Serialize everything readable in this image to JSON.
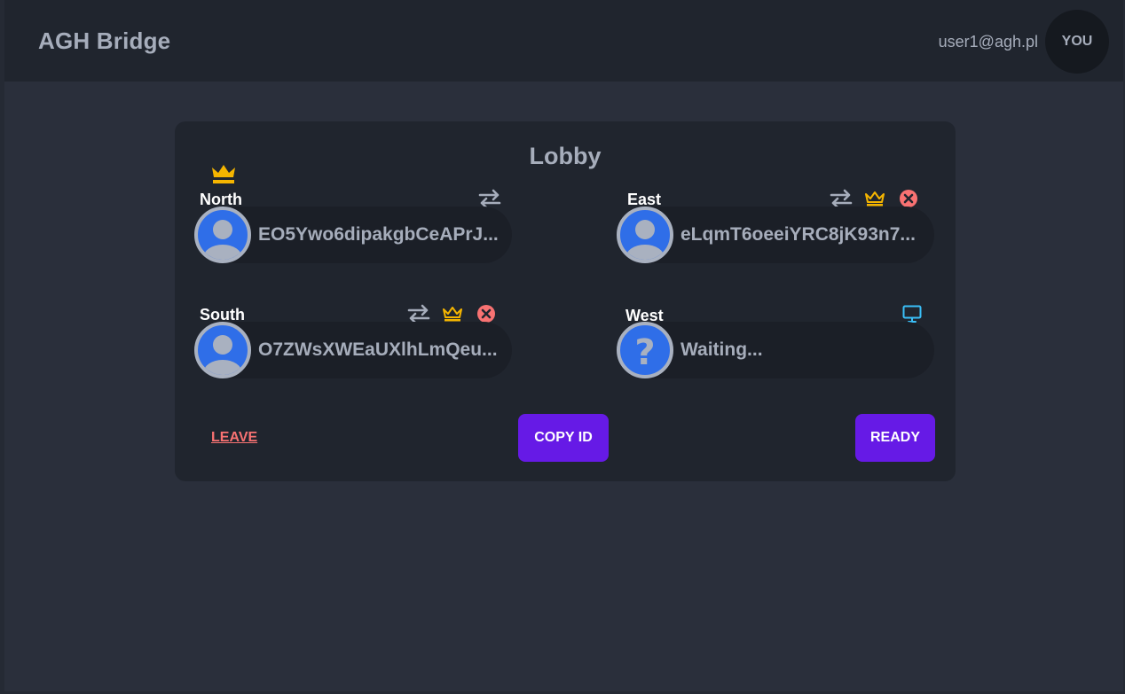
{
  "header": {
    "brand": "AGH Bridge",
    "user_email": "user1@agh.pl",
    "avatar_label": "YOU"
  },
  "lobby": {
    "title": "Lobby",
    "seats": [
      {
        "position": "North",
        "player": "EO5Ywo6dipakgbCeAPrJ...",
        "host": true,
        "actions": [
          "swap-icon"
        ]
      },
      {
        "position": "East",
        "player": "eLqmT6oeeiYRC8jK93n7...",
        "host": false,
        "actions": [
          "swap-icon",
          "crown-icon",
          "kick-icon"
        ]
      },
      {
        "position": "South",
        "player": "O7ZWsXWEaUXlhLmQeu...",
        "host": false,
        "actions": [
          "swap-icon",
          "crown-icon",
          "kick-icon"
        ]
      },
      {
        "position": "West",
        "player": "Waiting...",
        "host": false,
        "actions": [
          "computer-icon"
        ]
      }
    ],
    "leave_label": "LEAVE",
    "copy_id_label": "COPY ID",
    "ready_label": "READY"
  },
  "colors": {
    "accent": "#661ae6",
    "crown": "#f5b500",
    "error": "#f87272",
    "info": "#3abff8",
    "avatar_bg": "#2f6ee8"
  }
}
